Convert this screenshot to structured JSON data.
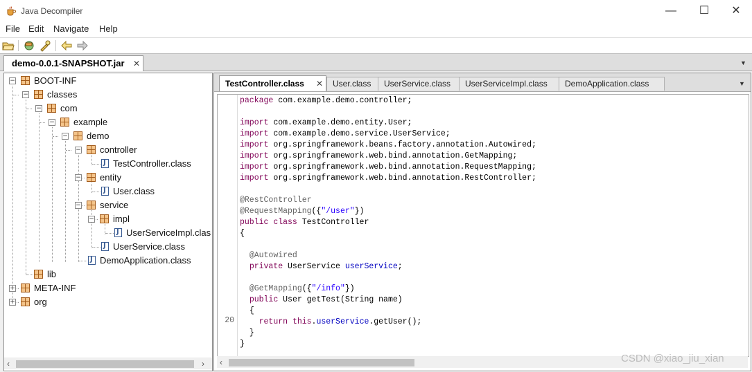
{
  "window": {
    "title": "Java Decompiler",
    "minimize": "—",
    "maximize": "☐",
    "close": "✕"
  },
  "menu": [
    "File",
    "Edit",
    "Navigate",
    "Help"
  ],
  "toolbar_icons": [
    "open-folder-icon",
    "open-type-icon",
    "search-icon",
    "back-arrow-icon",
    "forward-arrow-icon"
  ],
  "jar_tab": {
    "label": "demo-0.0.1-SNAPSHOT.jar",
    "close": "✕"
  },
  "tree": [
    {
      "label": "BOOT-INF",
      "kind": "pkg",
      "expander": "−"
    },
    {
      "label": "classes",
      "kind": "pkg",
      "expander": "−"
    },
    {
      "label": "com",
      "kind": "pkg",
      "expander": "−"
    },
    {
      "label": "example",
      "kind": "pkg",
      "expander": "−"
    },
    {
      "label": "demo",
      "kind": "pkg",
      "expander": "−"
    },
    {
      "label": "controller",
      "kind": "pkg",
      "expander": "−"
    },
    {
      "label": "TestController.class",
      "kind": "file"
    },
    {
      "label": "entity",
      "kind": "pkg",
      "expander": "−"
    },
    {
      "label": "User.class",
      "kind": "file"
    },
    {
      "label": "service",
      "kind": "pkg",
      "expander": "−"
    },
    {
      "label": "impl",
      "kind": "pkg",
      "expander": "−"
    },
    {
      "label": "UserServiceImpl.clas",
      "kind": "file"
    },
    {
      "label": "UserService.class",
      "kind": "file"
    },
    {
      "label": "DemoApplication.class",
      "kind": "file"
    },
    {
      "label": "lib",
      "kind": "pkg"
    },
    {
      "label": "META-INF",
      "kind": "pkg",
      "expander": "+"
    },
    {
      "label": "org",
      "kind": "pkg",
      "expander": "+"
    }
  ],
  "editor_tabs": [
    {
      "label": "TestController.class",
      "active": true,
      "close": "✕"
    },
    {
      "label": "User.class"
    },
    {
      "label": "UserService.class"
    },
    {
      "label": "UserServiceImpl.class"
    },
    {
      "label": "DemoApplication.class"
    }
  ],
  "code": {
    "l1": [
      "package",
      " com.example.demo.controller;"
    ],
    "imports": [
      "com.example.demo.entity.User;",
      "com.example.demo.service.UserService;",
      "org.springframework.beans.factory.annotation.Autowired;",
      "org.springframework.web.bind.annotation.GetMapping;",
      "org.springframework.web.bind.annotation.RequestMapping;",
      "org.springframework.web.bind.annotation.RestController;"
    ],
    "import_kw": "import",
    "rest_controller": "@RestController",
    "request_mapping": "@RequestMapping",
    "request_mapping_open": "({",
    "request_mapping_value": "\"/user\"",
    "request_mapping_close": "})",
    "public": "public",
    "class": "class",
    "class_name": " TestController",
    "open_brace": "{",
    "autowired": "@Autowired",
    "private": "private",
    "field_type": " UserService ",
    "field_name": "userService",
    "semi": ";",
    "get_mapping": "@GetMapping",
    "get_mapping_open": "({",
    "get_mapping_value": "\"/info\"",
    "get_mapping_close": "})",
    "method_sig": " User getTest(String name)",
    "method_open": "{",
    "return": "return",
    "this": "this",
    "dot": ".",
    "call_field": "userService",
    "call_rest": ".getUser();",
    "method_close": "}",
    "class_close": "}",
    "line_number": "20"
  },
  "scroll": {
    "left": "‹",
    "right": "›"
  },
  "watermark": "CSDN @xiao_jiu_xian",
  "colors": {
    "keyword": "#7f0055",
    "annotation": "#646464",
    "string": "#2a00ff",
    "field": "#0000c0"
  }
}
